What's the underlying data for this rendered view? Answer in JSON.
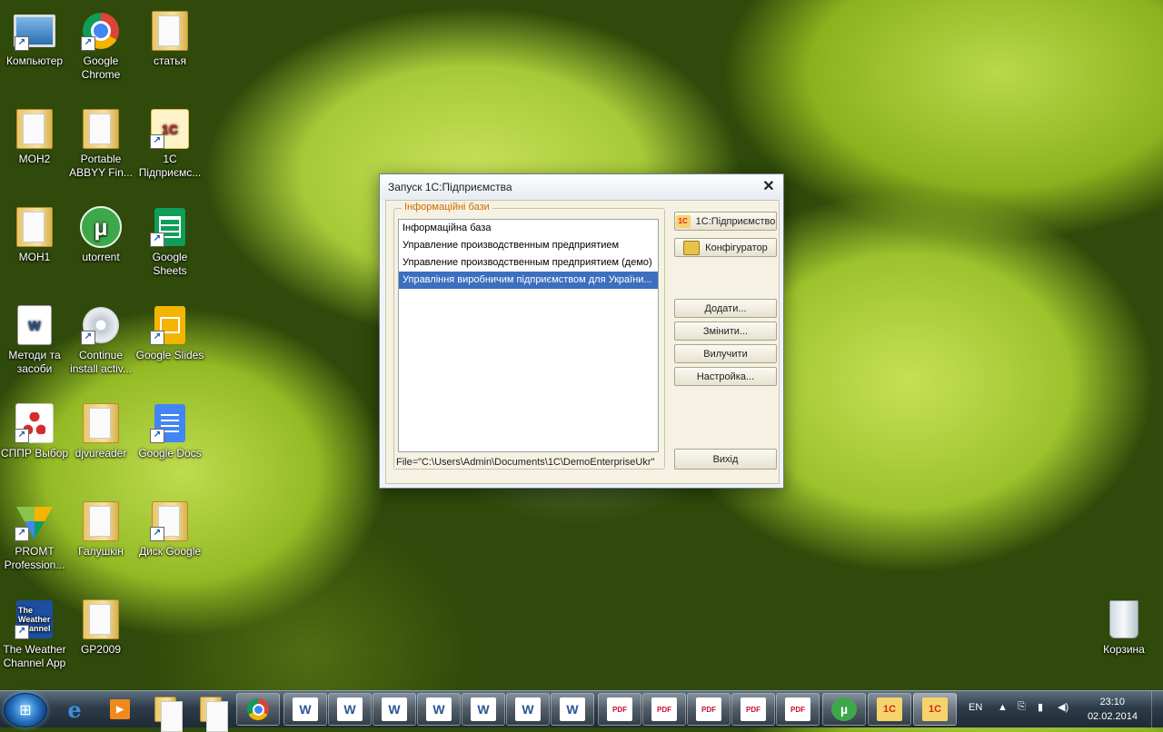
{
  "desktop": {
    "icons": [
      {
        "label": "Компьютер"
      },
      {
        "label": "Google Chrome"
      },
      {
        "label": "статья"
      },
      {
        "label": "МОН2"
      },
      {
        "label": "Portable ABBYY Fin..."
      },
      {
        "label": "1С Підприємс..."
      },
      {
        "label": "МОН1"
      },
      {
        "label": "utorrent"
      },
      {
        "label": "Google Sheets"
      },
      {
        "label": "Методи та засоби"
      },
      {
        "label": "Continue install activ..."
      },
      {
        "label": "Google Slides"
      },
      {
        "label": "СППР Выбор"
      },
      {
        "label": "djvureader"
      },
      {
        "label": "Google Docs"
      },
      {
        "label": "PROMT Profession..."
      },
      {
        "label": "Галушкін"
      },
      {
        "label": "Диск Google"
      },
      {
        "label": "The Weather Channel App"
      },
      {
        "label": "GP2009"
      },
      {
        "label": "Корзина"
      }
    ],
    "icon_glyphs": {
      "chrome": "◉",
      "utorrent": "µ",
      "word": "W",
      "weather": "The Weather Channel"
    }
  },
  "dialog": {
    "title": "Запуск 1С:Підприємства",
    "close_glyph": "✕",
    "group_title": "Інформаційні бази",
    "databases": [
      "Інформаційна база",
      "Управление производственным предприятием",
      "Управление производственным предприятием (демо)",
      "Управління виробничим підприємством для України..."
    ],
    "selected_index": 3,
    "path": "File=\"C:\\Users\\Admin\\Documents\\1C\\DemoEnterpriseUkr\"",
    "buttons": {
      "enterprise": "1С:Підприємство",
      "configurator": "Конфігуратор",
      "add": "Додати...",
      "edit": "Змінити...",
      "delete": "Вилучити",
      "settings": "Настройка...",
      "exit": "Вихід"
    },
    "enterprise_icon_text": "1С"
  },
  "taskbar": {
    "start_glyph": "⊞",
    "word_glyph": "W",
    "pdf_glyph": "PDF",
    "onec_glyph": "1С",
    "tray": {
      "lang": "EN",
      "time": "23:10",
      "date": "02.02.2014"
    }
  },
  "colors": {
    "accent_select": "#3d6fbf",
    "group_title": "#cc6b00",
    "taskbar": "#2e3c49"
  }
}
